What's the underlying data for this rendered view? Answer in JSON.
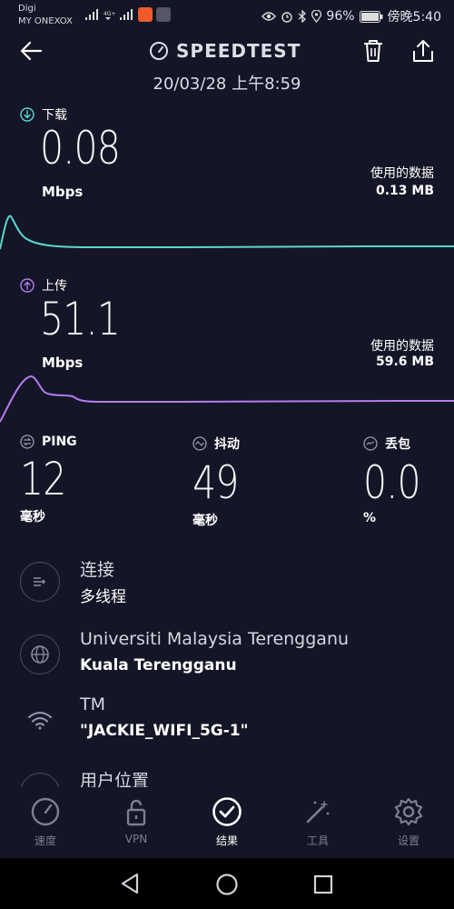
{
  "status": {
    "carrier_line1": "Digi",
    "carrier_line2": "MY ONEXOX",
    "battery": "96%",
    "time": "傍晚5:40"
  },
  "header": {
    "title": "SPEEDTEST",
    "datetime": "20/03/28 上午8:59"
  },
  "download": {
    "label": "下载",
    "value": "0.08",
    "unit": "Mbps",
    "used_label": "使用的数据",
    "used_value": "0.13 MB",
    "color": "#5ad8d4"
  },
  "upload": {
    "label": "上传",
    "value": "51.1",
    "unit": "Mbps",
    "used_label": "使用的数据",
    "used_value": "59.6 MB",
    "color": "#b77cf2"
  },
  "stats": {
    "ping": {
      "label": "PING",
      "value": "12",
      "unit": "毫秒"
    },
    "jitter": {
      "label": "抖动",
      "value": "49",
      "unit": "毫秒"
    },
    "loss": {
      "label": "丢包",
      "value": "0.0",
      "unit": "%"
    }
  },
  "info": {
    "connection": {
      "title": "连接",
      "sub": "多线程",
      "icon": "connections-icon"
    },
    "server": {
      "title": "Universiti Malaysia Terengganu",
      "sub": "Kuala Terengganu",
      "icon": "globe-icon"
    },
    "provider": {
      "title": "TM",
      "sub": "\"JACKIE_WIFI_5G-1\"",
      "icon": "wifi-icon"
    },
    "location": {
      "title": "用户位置",
      "icon": "location-icon"
    }
  },
  "nav": {
    "speed": "速度",
    "vpn": "VPN",
    "results": "结果",
    "tools": "工具",
    "settings": "设置"
  },
  "colors": {
    "background": "#141526",
    "download_accent": "#5ad8d4",
    "upload_accent": "#b77cf2"
  }
}
